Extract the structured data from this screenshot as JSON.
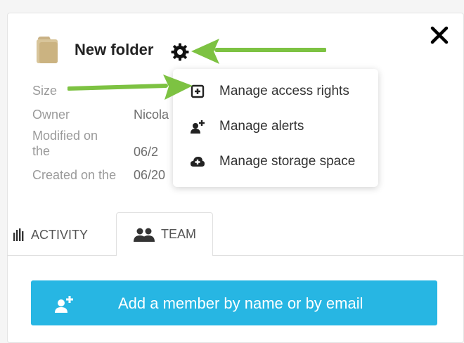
{
  "folder": {
    "title": "New folder",
    "icon": "folder-icon"
  },
  "close_icon": "close-icon",
  "gear_icon": "gear-icon",
  "details": {
    "size_label": "Size",
    "owner_label": "Owner",
    "owner_value": "Nicola",
    "modified_label_line1": "Modified on",
    "modified_label_line2": "the",
    "modified_value": "06/2",
    "created_label": "Created on the",
    "created_value": "06/20"
  },
  "menu": {
    "items": [
      {
        "label": "Manage access rights",
        "icon": "add-box-icon"
      },
      {
        "label": "Manage alerts",
        "icon": "user-plus-icon"
      },
      {
        "label": "Manage storage space",
        "icon": "cloud-plus-icon"
      }
    ]
  },
  "tabs": {
    "activity_label": "ACTIVITY",
    "team_label": "TEAM",
    "active": "TEAM"
  },
  "add_member": {
    "label": "Add a member by name or by email",
    "icon": "add-user-icon"
  },
  "colors": {
    "accent": "#27b6e3",
    "arrow": "#7dc242"
  }
}
